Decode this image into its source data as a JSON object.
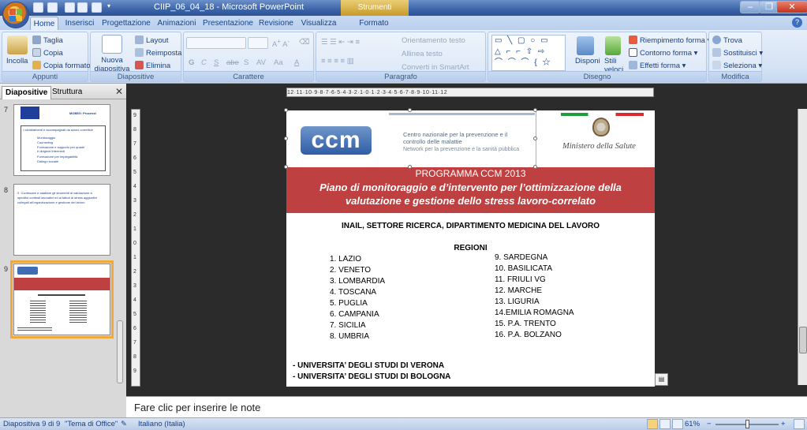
{
  "window": {
    "title": "CIIP_06_04_18 - Microsoft PowerPoint",
    "contextual_title": "Strumenti immagine",
    "minimize": "–",
    "maximize": "❐",
    "close": "✕"
  },
  "tabs": [
    "Home",
    "Inserisci",
    "Progettazione",
    "Animazioni",
    "Presentazione",
    "Revisione",
    "Visualizza",
    "Formato"
  ],
  "help": "?",
  "ribbon": {
    "appunti": {
      "label": "Appunti",
      "incolla": "Incolla",
      "taglia": "Taglia",
      "copia": "Copia",
      "copia_formato": "Copia formato"
    },
    "diapositive": {
      "label": "Diapositive",
      "nuova": "Nuova diapositiva",
      "layout": "Layout",
      "reimposta": "Reimposta",
      "elimina": "Elimina"
    },
    "carattere": {
      "label": "Carattere",
      "grassetto": "G",
      "corsivo": "C",
      "sottolineato": "S",
      "barrato": "abe",
      "ombra": "S",
      "spaziatura": "AV",
      "maiusc": "Aa",
      "colore": "A"
    },
    "paragrafo": {
      "label": "Paragrafo",
      "orientamento": "Orientamento testo",
      "allinea": "Allinea testo",
      "smartart": "Converti in SmartArt"
    },
    "disegno": {
      "label": "Disegno",
      "disponi": "Disponi",
      "stili": "Stili veloci",
      "riempimento": "Riempimento forma",
      "contorno": "Contorno forma",
      "effetti": "Effetti forma"
    },
    "modifica": {
      "label": "Modifica",
      "trova": "Trova",
      "sostituisci": "Sostituisci",
      "seleziona": "Seleziona"
    }
  },
  "panel": {
    "tab_diapositive": "Diapositive",
    "tab_struttura": "Struttura",
    "close": "✕",
    "thumbs": [
      {
        "num": "7",
        "title": "MOBEX: Processi",
        "lines": [
          "I cambiamenti e accompagnati da azioni correttive",
          "Monitoraggio",
          "Counseling",
          "Formazione e supporto per quadri",
          "e dirigenti intermedi",
          "Formazione per impiegabilità",
          "Dialogo sociale"
        ]
      },
      {
        "num": "8",
        "lines": [
          "2. Continuare e adattare gli strumenti di valutazione a",
          "specifici contesti lavorativi ed ai fattori di stress aggiuntivi",
          "collegati all'organizzazione e gestione del lavoro"
        ]
      },
      {
        "num": "9"
      }
    ]
  },
  "ruler": {
    "h": "12·11·10·9·8·7·6·5·4·3·2·1·0·1·2·3·4·5·6·7·8·9·10·11·12",
    "v": [
      "9",
      "8",
      "7",
      "6",
      "5",
      "4",
      "3",
      "2",
      "1",
      "0",
      "1",
      "2",
      "3",
      "4",
      "5",
      "6",
      "7",
      "8",
      "9"
    ]
  },
  "slide": {
    "logo": "ccm",
    "ccm_line1": "Centro nazionale per la prevenzione e il controllo delle malattie",
    "ccm_line2": "Network per la prevenzione e la sanità pubblica",
    "ministero": "Ministero della Salute",
    "program": "PROGRAMMA CCM 2013",
    "plan": "Piano di monitoraggio e d’intervento per l’ottimizzazione della valutazione e gestione dello stress lavoro-correlato",
    "inail": "INAIL, SETTORE RICERCA, DIPARTIMENTO MEDICINA DEL LAVORO",
    "regioni_heading": "REGIONI",
    "regions_left": [
      "1. LAZIO",
      "2. VENETO",
      "3. LOMBARDIA",
      "4. TOSCANA",
      "5. PUGLIA",
      "6. CAMPANIA",
      "7. SICILIA",
      "8. UMBRIA"
    ],
    "regions_right": [
      "9. SARDEGNA",
      "10. BASILICATA",
      "11. FRIULI VG",
      "12. MARCHE",
      "13. LIGURIA",
      "14.EMILIA ROMAGNA",
      "15. P.A. TRENTO",
      "16. P.A. BOLZANO"
    ],
    "uni1": "- UNIVERSITA’ DEGLI STUDI DI VERONA",
    "uni2": "- UNIVERSITA’ DEGLI STUDI DI BOLOGNA"
  },
  "notes_placeholder": "Fare clic per inserire le note",
  "status": {
    "slide": "Diapositiva 9 di 9",
    "theme": "\"Tema di Office\"",
    "language": "Italiano (Italia)",
    "zoom": "61%",
    "zoom_minus": "−",
    "zoom_plus": "+"
  },
  "colors": {
    "accent": "#bf4040",
    "ribbon": "#dbe7f7",
    "selection": "#f2a93c"
  }
}
